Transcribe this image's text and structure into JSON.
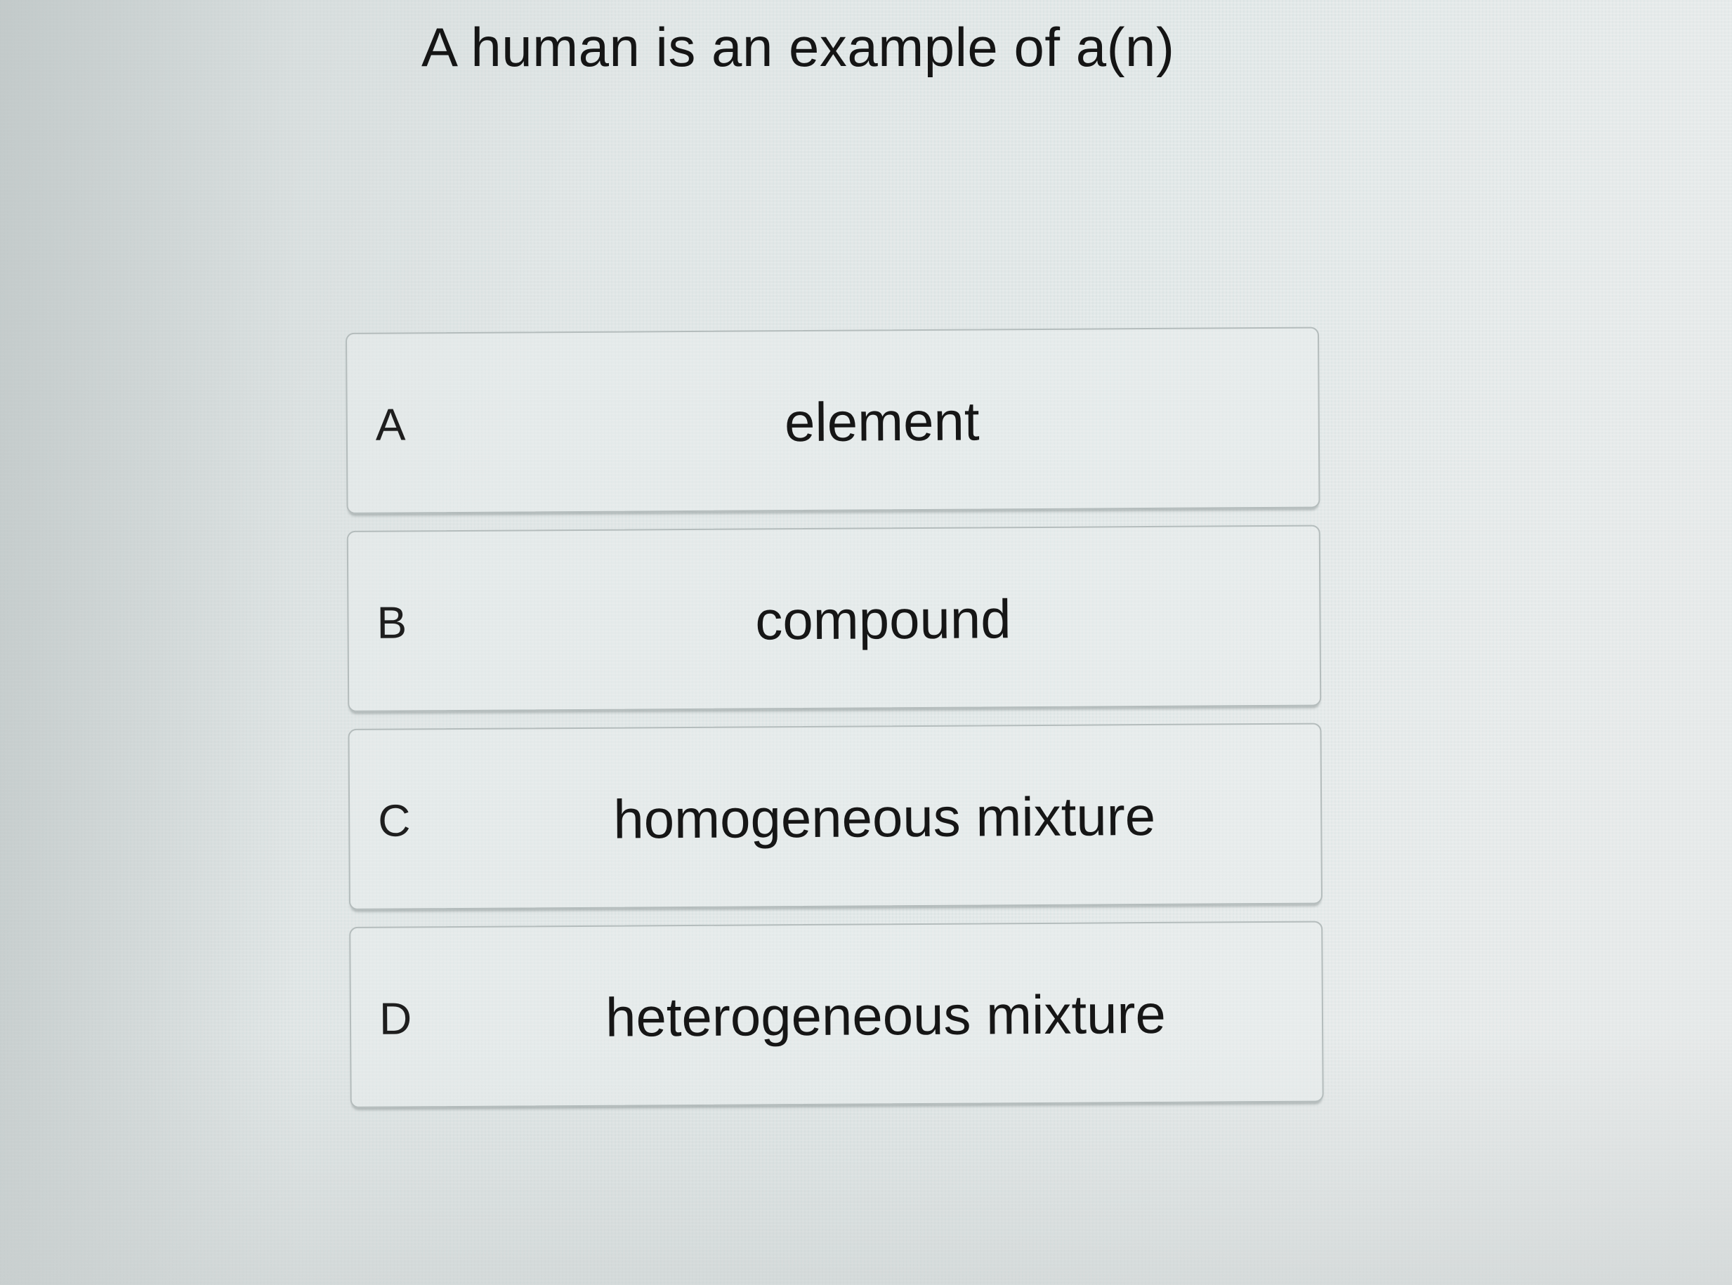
{
  "question": {
    "text": "A human is an example of a(n)"
  },
  "options": [
    {
      "letter": "A",
      "text": "element"
    },
    {
      "letter": "B",
      "text": "compound"
    },
    {
      "letter": "C",
      "text": "homogeneous mixture"
    },
    {
      "letter": "D",
      "text": "heterogeneous mixture"
    }
  ]
}
